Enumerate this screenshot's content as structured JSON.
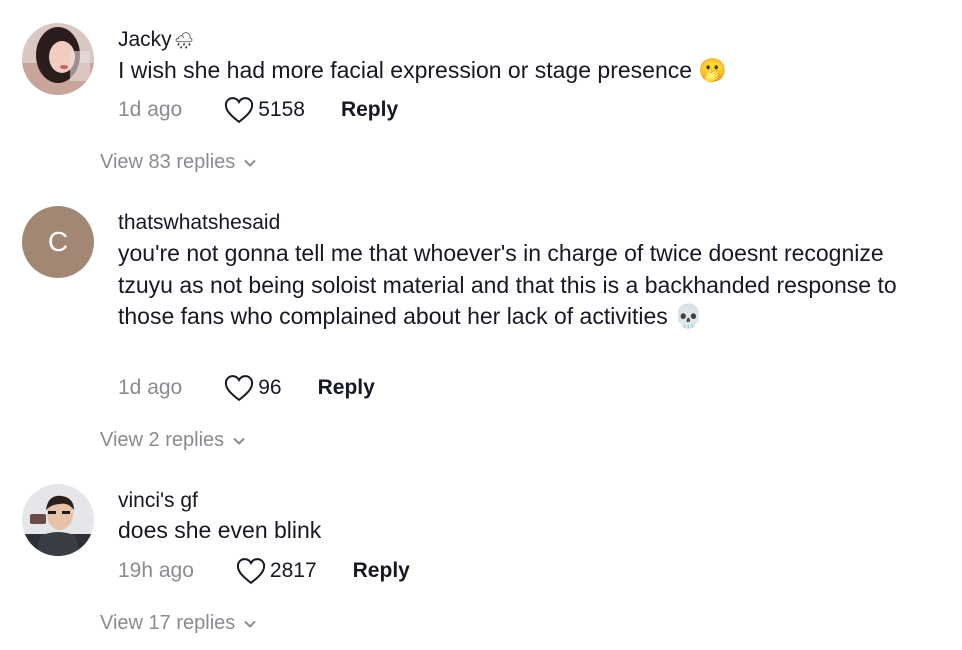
{
  "comments": [
    {
      "username": "Jacky",
      "username_icon": "cloud-rain-icon",
      "text": "I wish she had more facial expression or stage presence 🫢",
      "time": "1d ago",
      "likes": "5158",
      "reply_label": "Reply",
      "view_replies": "View 83 replies"
    },
    {
      "username": "thatswhatshesaid",
      "avatar_initial": "C",
      "text": "you're not gonna tell me that whoever's in charge of twice doesnt recognize tzuyu as not being soloist material and that this is a backhanded response to those fans who complained about her lack of activities 💀",
      "time": "1d ago",
      "likes": "96",
      "reply_label": "Reply",
      "view_replies": "View 2 replies"
    },
    {
      "username": "vinci's gf",
      "text": "does she even blink",
      "time": "19h ago",
      "likes": "2817",
      "reply_label": "Reply",
      "view_replies": "View 17 replies"
    }
  ],
  "colors": {
    "text": "#161823",
    "muted": "#8a8b91",
    "avatar_initial_bg": "#a28874"
  }
}
